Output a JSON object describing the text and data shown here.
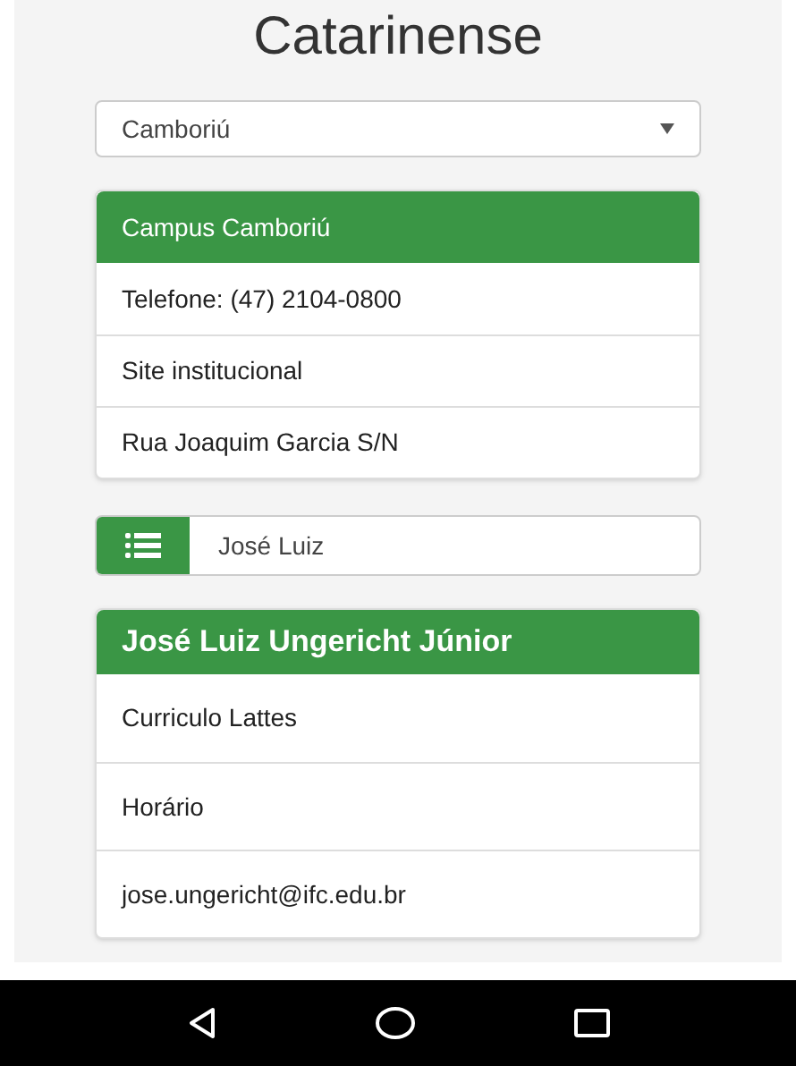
{
  "heading": "Catarinense",
  "campus_select": {
    "value": "Camboriú"
  },
  "campus_card": {
    "title": "Campus Camboriú",
    "items": [
      "Telefone: (47) 2104-0800",
      "Site institucional",
      "Rua Joaquim Garcia S/N"
    ]
  },
  "search": {
    "value": "José Luiz"
  },
  "person_card": {
    "title": "José Luiz Ungericht Júnior",
    "items": [
      "Curriculo Lattes",
      "Horário",
      "jose.ungericht@ifc.edu.br"
    ]
  },
  "nav_bar": {
    "buttons": [
      {
        "kind": "back"
      },
      {
        "kind": "home"
      },
      {
        "kind": "recents"
      }
    ]
  }
}
